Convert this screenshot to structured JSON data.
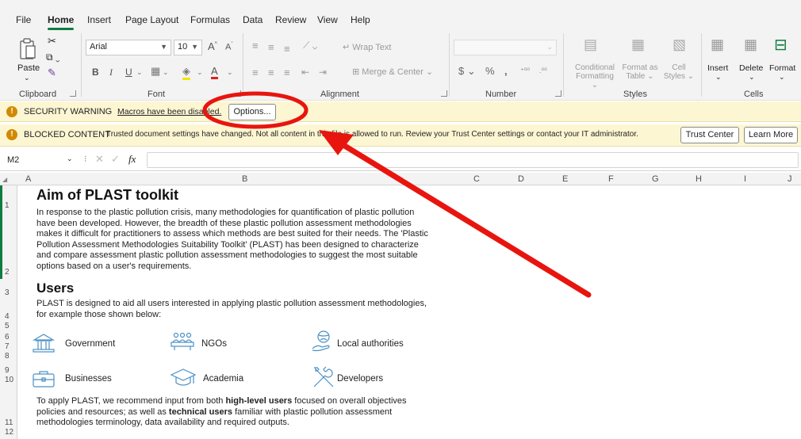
{
  "menu": {
    "tabs": [
      "File",
      "Home",
      "Insert",
      "Page Layout",
      "Formulas",
      "Data",
      "Review",
      "View",
      "Help"
    ]
  },
  "ribbon": {
    "clipboard": {
      "paste": "Paste",
      "label": "Clipboard"
    },
    "font": {
      "name": "Arial",
      "size": "10",
      "label": "Font"
    },
    "alignment": {
      "wrap_text": "Wrap Text",
      "merge_center": "Merge & Center",
      "label": "Alignment"
    },
    "number": {
      "label": "Number"
    },
    "styles": {
      "conditional_1": "Conditional",
      "conditional_2": "Formatting",
      "format_table_1": "Format as",
      "format_table_2": "Table",
      "cell_styles_1": "Cell",
      "cell_styles_2": "Styles",
      "label": "Styles"
    },
    "cells": {
      "insert": "Insert",
      "delete": "Delete",
      "format": "Format",
      "label": "Cells"
    }
  },
  "security_bar": {
    "title": "SECURITY WARNING",
    "message": "Macros have been disabled.",
    "button": "Options..."
  },
  "blocked_bar": {
    "title": "BLOCKED CONTENT",
    "message": "Trusted document settings have changed. Not all content in this file is allowed to run. Review your Trust Center settings or contact your IT administrator.",
    "button_trust": "Trust Center",
    "button_learn": "Learn More"
  },
  "formula_bar": {
    "cell_ref": "M2",
    "fx": "fx"
  },
  "columns": [
    "A",
    "B",
    "C",
    "D",
    "E",
    "F",
    "G",
    "H",
    "I",
    "J"
  ],
  "rows": [
    "1",
    "2",
    "3",
    "4",
    "5",
    "6",
    "7",
    "8",
    "9",
    "10",
    "11",
    "12"
  ],
  "content": {
    "heading_aim": "Aim of PLAST toolkit",
    "aim_lines": [
      "In response to the plastic pollution crisis, many methodologies for quantification of plastic pollution",
      "have been developed. However, the breadth of these plastic pollution assessment methodologies",
      "makes it difficult for practitioners to assess which methods are best suited for their needs. The 'Plastic",
      "Pollution Assessment Methodologies Suitability Toolkit' (PLAST) has been designed to characterize",
      "and compare assessment plastic pollution assessment methodologies to suggest the most suitable",
      "options based on a user's requirements."
    ],
    "heading_users": "Users",
    "users_lines": [
      "PLAST is designed to aid all users interested in applying plastic pollution assessment methodologies,",
      "for example those shown below:"
    ],
    "user_types": [
      "Government",
      "NGOs",
      "Local authorities",
      "Businesses",
      "Academia",
      "Developers"
    ],
    "apply": {
      "l1_pre": "To apply PLAST, we recommend input from both ",
      "l1_bold": "high-level users",
      "l1_post": " focused on overall objectives",
      "l2_pre": "policies and resources; as well as ",
      "l2_bold": "technical users",
      "l2_post": " familiar with plastic pollution assessment",
      "l3": "methodologies terminology, data availability and required outputs."
    }
  },
  "colors": {
    "accent": "#107c41",
    "annotation": "#e8150f",
    "warning_bg": "#fdf6d3",
    "icon_blue": "#4a90c4"
  }
}
